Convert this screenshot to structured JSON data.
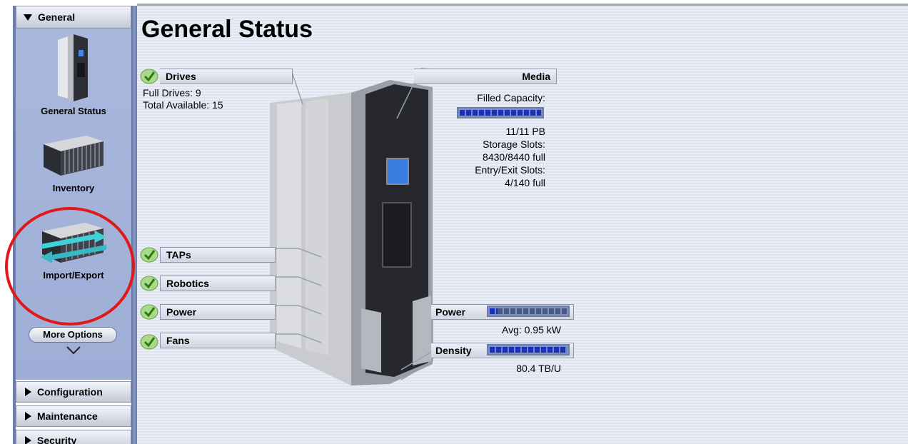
{
  "sidebar": {
    "general_header": "General",
    "tiles": [
      {
        "label": "General Status",
        "icon": "library-cabinet-icon"
      },
      {
        "label": "Inventory",
        "icon": "tape-cartridges-icon"
      },
      {
        "label": "Import/Export",
        "icon": "import-export-icon"
      }
    ],
    "more_options": "More Options",
    "sections": [
      "Configuration",
      "Maintenance",
      "Security"
    ]
  },
  "main": {
    "title": "General Status",
    "drives": {
      "label": "Drives",
      "full": "Full Drives: 9",
      "total": "Total Available: 15",
      "status": "ok"
    },
    "media": {
      "label": "Media",
      "filled_capacity_label": "Filled Capacity:",
      "filled_capacity_value": "11/11 PB",
      "filled_capacity_fraction": 1.0,
      "storage_slots_label": "Storage Slots:",
      "storage_slots_value": "8430/8440 full",
      "entry_exit_label": "Entry/Exit Slots:",
      "entry_exit_value": "4/140 full"
    },
    "components": [
      {
        "label": "TAPs",
        "status": "ok"
      },
      {
        "label": "Robotics",
        "status": "ok"
      },
      {
        "label": "Power",
        "status": "ok"
      },
      {
        "label": "Fans",
        "status": "ok"
      }
    ],
    "power": {
      "label": "Power",
      "avg": "Avg: 0.95 kW",
      "fraction": 0.1
    },
    "density": {
      "label": "Density",
      "value": "80.4 TB/U",
      "fraction": 1.0
    }
  },
  "colors": {
    "accent": "#1d2fb8",
    "highlight": "#e01818",
    "ok": "#5cb32a"
  }
}
